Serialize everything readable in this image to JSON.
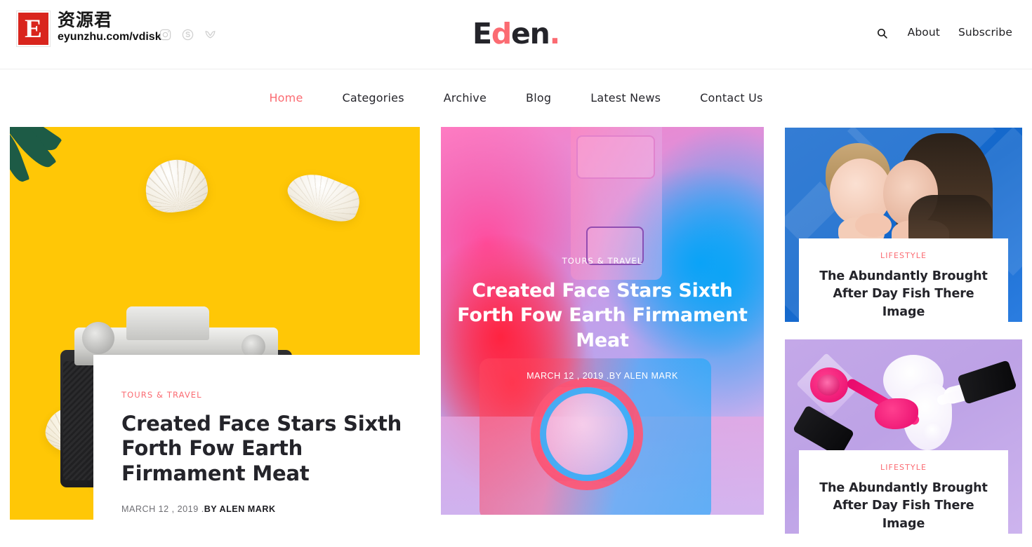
{
  "brand": {
    "mark_letter": "E",
    "cn_name": "资源君",
    "url": "eyunzhu.com/vdisk",
    "social": [
      {
        "name": "instagram-icon"
      },
      {
        "name": "skype-icon"
      },
      {
        "name": "bird-icon"
      }
    ]
  },
  "header": {
    "logo_part1": "E",
    "logo_part2": "d",
    "logo_part3": "en",
    "logo_part4": ".",
    "search_label": "Search",
    "links": [
      {
        "label": "About"
      },
      {
        "label": "Subscribe"
      }
    ]
  },
  "nav": {
    "items": [
      {
        "label": "Home",
        "active": true
      },
      {
        "label": "Categories",
        "active": false
      },
      {
        "label": "Archive",
        "active": false
      },
      {
        "label": "Blog",
        "active": false
      },
      {
        "label": "Latest News",
        "active": false
      },
      {
        "label": "Contact Us",
        "active": false
      }
    ]
  },
  "hero": {
    "category": "TOURS & TRAVEL",
    "title": "Created Face Stars Sixth Forth Fow Earth Firmament Meat",
    "date": "MARCH 12 , 2019 .",
    "author": "BY ALEN MARK",
    "image_alt": "vintage-camera-on-yellow-background"
  },
  "feature": {
    "category": "TOURS & TRAVEL",
    "title": "Created Face Stars Sixth Forth Fow Earth Firmament Meat",
    "meta": "MARCH 12 , 2019 .BY ALEN MARK",
    "image_alt": "neon-pink-blue-camera"
  },
  "side_cards": [
    {
      "category": "LIFESTYLE",
      "title": "The Abundantly Brought After Day Fish There Image",
      "image_alt": "mother-kissing-child-blue-door"
    },
    {
      "category": "LIFESTYLE",
      "title": "The Abundantly Brought After Day Fish There Image",
      "image_alt": "pink-nail-polish-on-purple"
    }
  ],
  "colors": {
    "accent_pink": "#fb6b72",
    "brand_red": "#d9251d",
    "text_dark": "#24242a",
    "meta_gray": "#6f6f74",
    "hero_yellow": "#ffc706"
  }
}
